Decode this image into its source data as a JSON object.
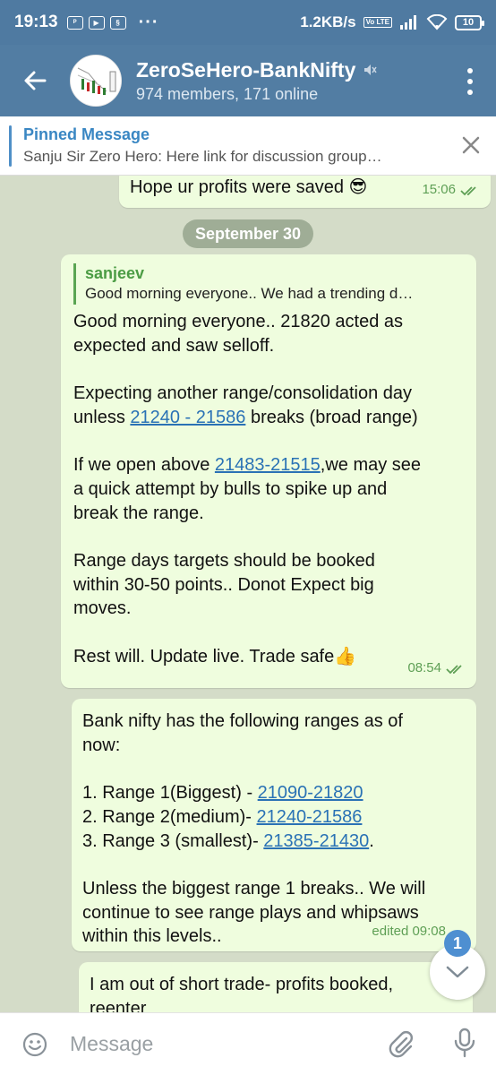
{
  "status_bar": {
    "time": "19:13",
    "app_icons": [
      "paytm-icon",
      "youtube-icon",
      "app-icon"
    ],
    "more": "···",
    "speed": "1.2KB/s",
    "network_tag": "Vo LTE",
    "battery": "10"
  },
  "header": {
    "title": "ZeroSeHero-BankNifty",
    "subtitle": "974 members, 171 online",
    "muted": true
  },
  "pinned": {
    "title": "Pinned Message",
    "text": "Sanju Sir Zero Hero: Here link for discussion group…"
  },
  "messages": [
    {
      "text": "Hope ur profits were saved 😎",
      "time": "15:06"
    },
    {
      "date": "September 30"
    },
    {
      "reply_name": "sanjeev",
      "reply_text": "Good morning everyone.. We had a trending d…",
      "line1": "Good morning everyone.. 21820 acted as",
      "line2": "expected and saw selloff.",
      "line3": "Expecting another range/consolidation day",
      "line4_pre": "unless ",
      "line4_link": "21240 - 21586",
      "line4_post": " breaks (broad range)",
      "line5_pre": "If we open above ",
      "line5_link": "21483-21515",
      "line5_post": ",we may see",
      "line6": "a quick attempt by bulls to spike up and",
      "line7": "break the range.",
      "line8": "Range days targets should be booked",
      "line9": "within 30-50 points.. Donot Expect big",
      "line10": "moves.",
      "line11": "Rest will. Update live. Trade safe👍",
      "time": "08:54"
    },
    {
      "line1": "Bank nifty has the following ranges as of",
      "line2": "now:",
      "r1_pre": "1. Range 1(Biggest) - ",
      "r1_link": "21090-21820",
      "r2_pre": "2. Range 2(medium)- ",
      "r2_link": "21240-21586",
      "r3_pre": "3. Range 3 (smallest)- ",
      "r3_link": "21385-21430",
      "r3_post": ".",
      "line3": "Unless the biggest range 1 breaks.. We will",
      "line4": "continue to see range plays and whipsaws",
      "line5": "within this levels..",
      "time": "edited 09:08"
    },
    {
      "line1": "I am out of short trade- profits booked,",
      "line2": "reenter"
    }
  ],
  "scroll_badge": "1",
  "input": {
    "placeholder": "Message"
  }
}
